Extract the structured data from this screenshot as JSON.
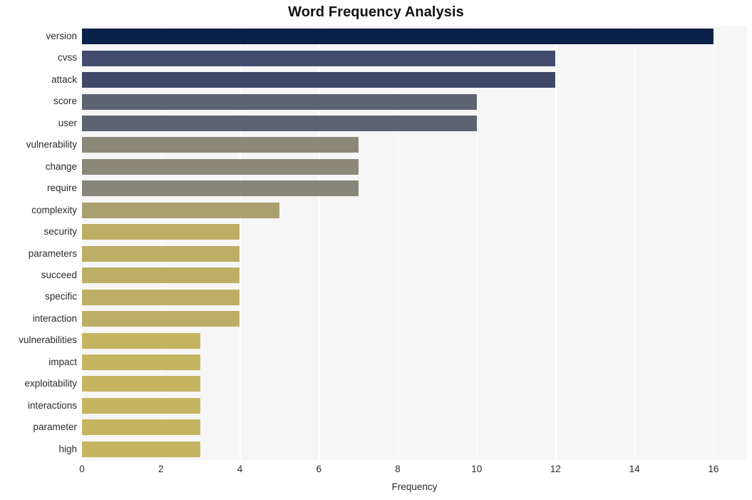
{
  "chart_data": {
    "type": "bar",
    "orientation": "horizontal",
    "title": "Word Frequency Analysis",
    "xlabel": "Frequency",
    "ylabel": "",
    "categories": [
      "version",
      "cvss",
      "attack",
      "score",
      "user",
      "vulnerability",
      "change",
      "require",
      "complexity",
      "security",
      "parameters",
      "succeed",
      "specific",
      "interaction",
      "vulnerabilities",
      "impact",
      "exploitability",
      "interactions",
      "parameter",
      "high"
    ],
    "values": [
      16,
      12,
      12,
      10,
      10,
      7,
      7,
      7,
      5,
      4,
      4,
      4,
      4,
      4,
      3,
      3,
      3,
      3,
      3,
      3
    ],
    "bar_colors": [
      "#0a2249",
      "#434c6e",
      "#3f4868",
      "#5e6372",
      "#5e6372",
      "#8b8878",
      "#8b8878",
      "#88857a",
      "#aa9f6e",
      "#bcaf65",
      "#bcaf65",
      "#bcaf65",
      "#bcaf65",
      "#bcaf65",
      "#c5b561",
      "#c5b561",
      "#c5b561",
      "#c5b561",
      "#c5b561",
      "#c5b561"
    ],
    "xlim": [
      0,
      16.85
    ],
    "xticks": [
      0,
      2,
      4,
      6,
      8,
      10,
      12,
      14,
      16
    ],
    "xtick_labels": [
      "0",
      "2",
      "4",
      "6",
      "8",
      "10",
      "12",
      "14",
      "16"
    ],
    "grid": true,
    "grid_axis": "x",
    "grid_color": "#ffffff",
    "plot_background": "#f6f6f7",
    "figure_background": "#ffffff",
    "legend": null
  }
}
